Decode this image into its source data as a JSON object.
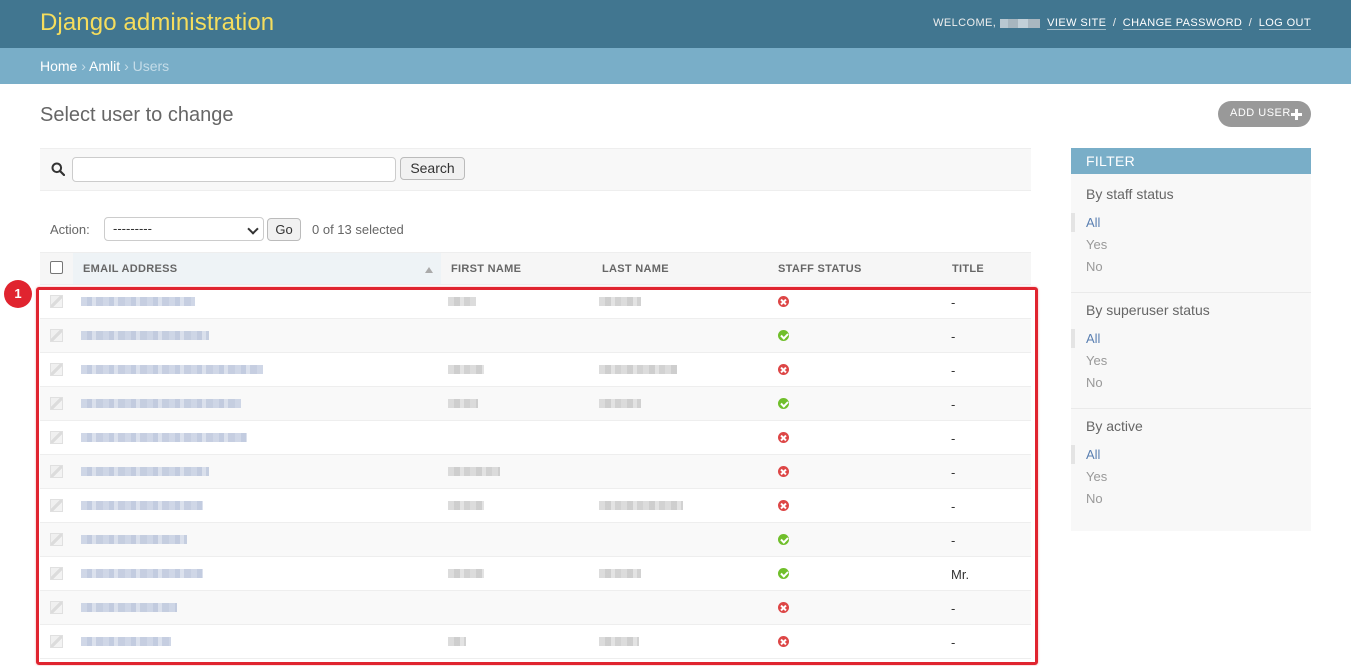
{
  "header": {
    "site_name": "Django administration",
    "welcome": "WELCOME, ",
    "view_site": "VIEW SITE",
    "change_password": "CHANGE PASSWORD",
    "log_out": "LOG OUT",
    "separator": "/"
  },
  "breadcrumbs": {
    "home": "Home",
    "app": "Amlit",
    "current": "Users",
    "separator": "›"
  },
  "page": {
    "title": "Select user to change",
    "add_button": "ADD USER"
  },
  "search": {
    "button": "Search",
    "value": ""
  },
  "actions": {
    "label": "Action:",
    "selected_option": "---------",
    "go": "Go",
    "counter": "0 of 13 selected"
  },
  "table": {
    "columns": [
      "EMAIL ADDRESS",
      "FIRST NAME",
      "LAST NAME",
      "STAFF STATUS",
      "TITLE"
    ],
    "rows": [
      {
        "staff": false,
        "title": "-"
      },
      {
        "staff": true,
        "title": "-"
      },
      {
        "staff": false,
        "title": "-"
      },
      {
        "staff": true,
        "title": "-"
      },
      {
        "staff": false,
        "title": "-"
      },
      {
        "staff": false,
        "title": "-"
      },
      {
        "staff": false,
        "title": "-"
      },
      {
        "staff": true,
        "title": "-"
      },
      {
        "staff": true,
        "title": "Mr."
      },
      {
        "staff": false,
        "title": "-"
      },
      {
        "staff": false,
        "title": "-"
      }
    ]
  },
  "annotation": {
    "marker": "1",
    "color": "#e0242f"
  },
  "filter": {
    "title": "FILTER",
    "groups": [
      {
        "heading": "By staff status",
        "options": [
          "All",
          "Yes",
          "No"
        ]
      },
      {
        "heading": "By superuser status",
        "options": [
          "All",
          "Yes",
          "No"
        ]
      },
      {
        "heading": "By active",
        "options": [
          "All",
          "Yes",
          "No"
        ]
      }
    ]
  },
  "colors": {
    "header_bg": "#417690",
    "branding": "#f5dd5d",
    "breadcrumb_bg": "#79aec8",
    "boolean_yes": "#70bf2b",
    "boolean_no": "#dd4646"
  }
}
